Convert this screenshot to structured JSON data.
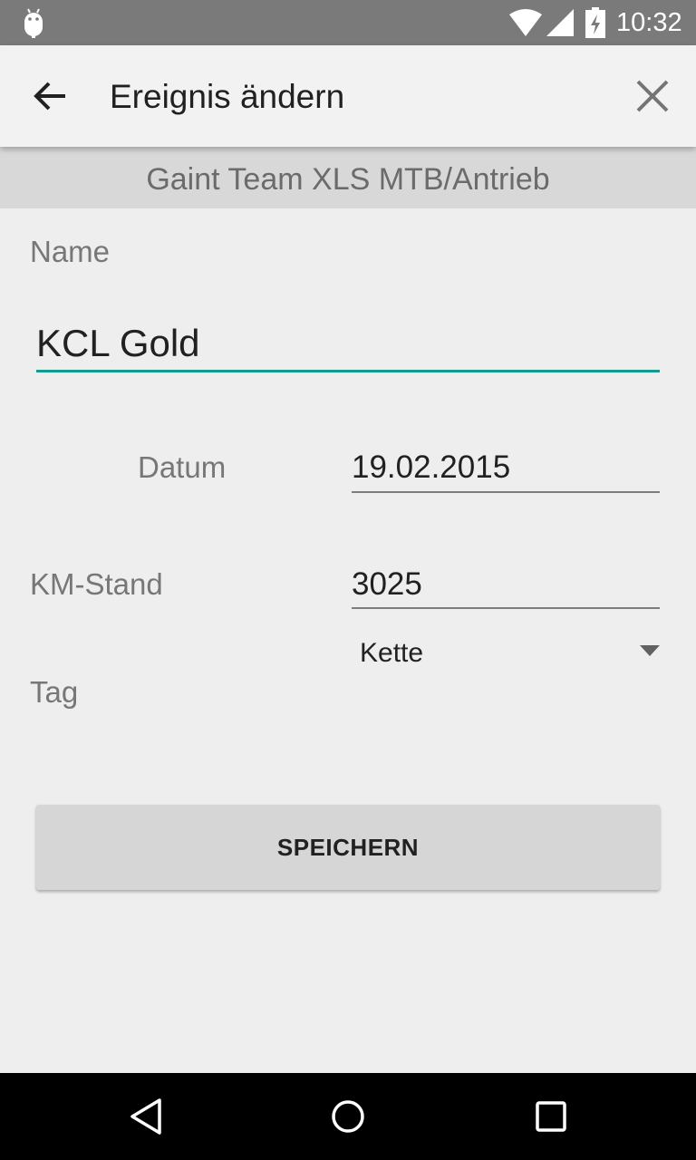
{
  "status_bar": {
    "time": "10:32",
    "icons": [
      "android-debug-icon",
      "wifi-icon",
      "signal-icon",
      "battery-charging-icon"
    ]
  },
  "app_bar": {
    "title": "Ereignis ändern",
    "icons": [
      "back-arrow-icon",
      "close-icon"
    ]
  },
  "subheader": {
    "text": "Gaint Team XLS MTB/Antrieb"
  },
  "form": {
    "name_label": "Name",
    "name_value": "KCL Gold",
    "datum_label": "Datum",
    "datum_value": "19.02.2015",
    "km_label": "KM-Stand",
    "km_value": "3025",
    "tag_label": "Tag",
    "tag_value": "Kette"
  },
  "actions": {
    "save_label": "SPEICHERN"
  },
  "colors": {
    "accent": "#139a8c",
    "status_bar": "#7a7a7a",
    "background": "#eeeeee",
    "subheader": "#d8d8d8"
  },
  "nav_bar": {
    "icons": [
      "nav-back-icon",
      "nav-home-icon",
      "nav-recents-icon"
    ]
  }
}
